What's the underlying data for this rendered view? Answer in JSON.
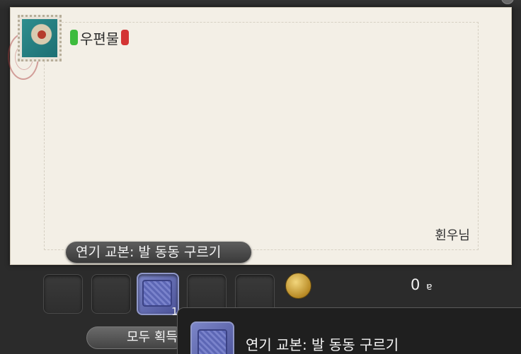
{
  "letter": {
    "sender_label": "우편물",
    "bracket_left": "",
    "bracket_right": "",
    "signature": "휜우님"
  },
  "attachments": {
    "caption": "연기 교본: 발 동동 구르기",
    "slots": [
      {
        "filled": false
      },
      {
        "filled": false
      },
      {
        "filled": true,
        "item_icon": "book-icon",
        "count": "1"
      },
      {
        "filled": false
      },
      {
        "filled": false
      }
    ],
    "gil_amount": "0",
    "gil_symbol": "ɐ"
  },
  "buttons": {
    "receive_all_label": "모두 획득"
  },
  "tooltip": {
    "item_name": "연기 교본: 발 동동 구르기",
    "item_icon": "book-icon"
  },
  "colors": {
    "paper": "#f3efe6",
    "bracket_green": "#3dbb3d",
    "bracket_red": "#d33434"
  }
}
